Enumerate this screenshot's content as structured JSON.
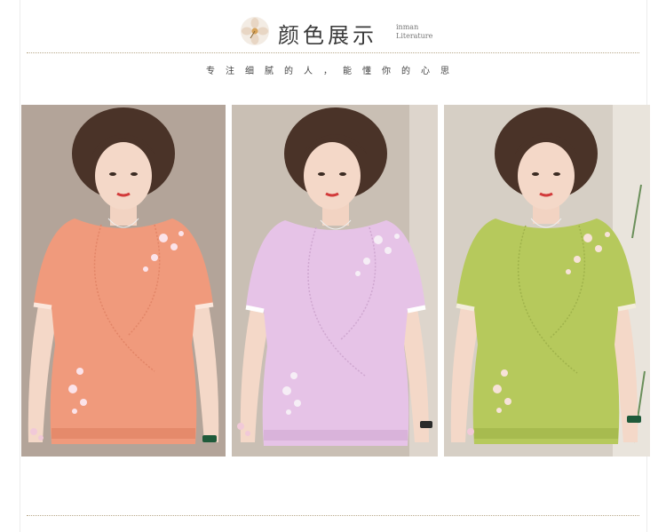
{
  "header": {
    "title": "颜色展示",
    "subtitle_line1": "inman",
    "subtitle_line2": "Literature",
    "logo_icon": "flower-logo-icon",
    "tagline": "专注细腻的人，能懂你的心思"
  },
  "colors": {
    "accent_dotted": "#b8a88a",
    "shirt_orange": "#f09a7c",
    "shirt_lilac": "#e6c3e7",
    "shirt_green": "#b6c95c"
  },
  "photos": [
    {
      "name": "photo-orange-shirt",
      "shirt_color": "#f09a7c",
      "trim_color": "#fbe7dc",
      "bg": "#b8aa9e"
    },
    {
      "name": "photo-lilac-shirt",
      "shirt_color": "#e6c3e7",
      "trim_color": "#ffffff",
      "bg": "#c9bfb4"
    },
    {
      "name": "photo-green-shirt",
      "shirt_color": "#b6c95c",
      "trim_color": "#f3eddc",
      "bg": "#d6cfc5"
    }
  ]
}
